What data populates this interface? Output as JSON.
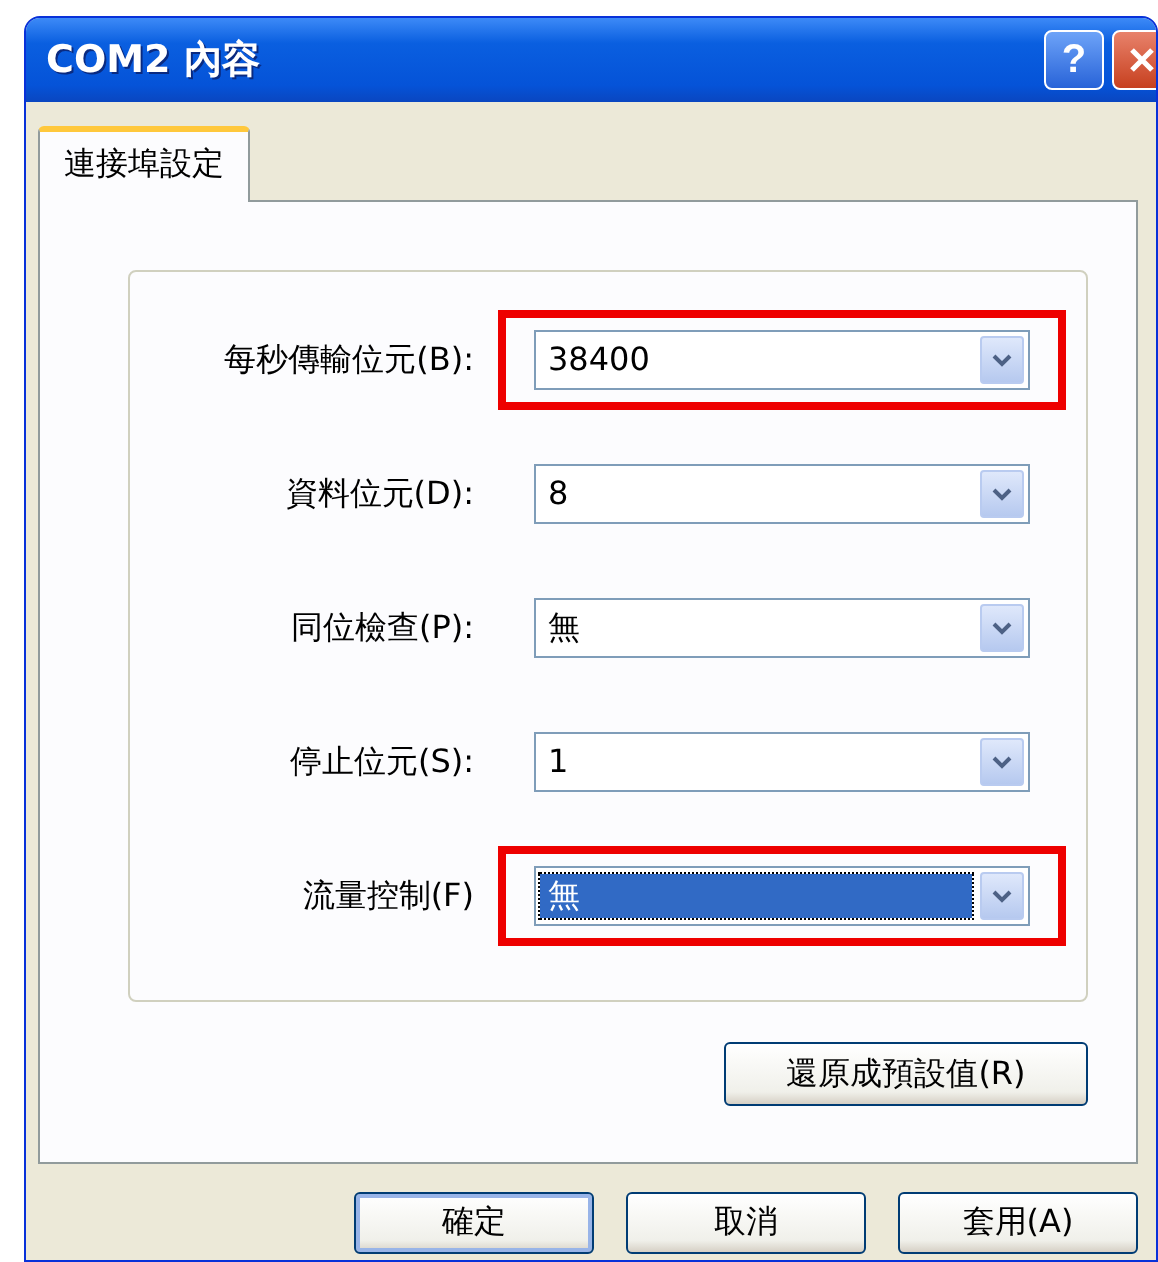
{
  "window": {
    "title": "COM2 內容",
    "help_button": "?"
  },
  "tabs": [
    {
      "label": "連接埠設定",
      "selected": true
    }
  ],
  "settings": [
    {
      "label": "每秒傳輸位元(B):",
      "value": "38400",
      "highlighted": true,
      "focused": false
    },
    {
      "label": "資料位元(D):",
      "value": "8",
      "highlighted": false,
      "focused": false
    },
    {
      "label": "同位檢查(P):",
      "value": "無",
      "highlighted": false,
      "focused": false
    },
    {
      "label": "停止位元(S):",
      "value": "1",
      "highlighted": false,
      "focused": false
    },
    {
      "label": "流量控制(F)",
      "value": "無",
      "highlighted": true,
      "focused": true
    }
  ],
  "restore_button": "還原成預設值(R)",
  "buttons": [
    {
      "label": "確定",
      "default": true
    },
    {
      "label": "取消",
      "default": false
    },
    {
      "label": "套用(A)",
      "default": false
    }
  ]
}
